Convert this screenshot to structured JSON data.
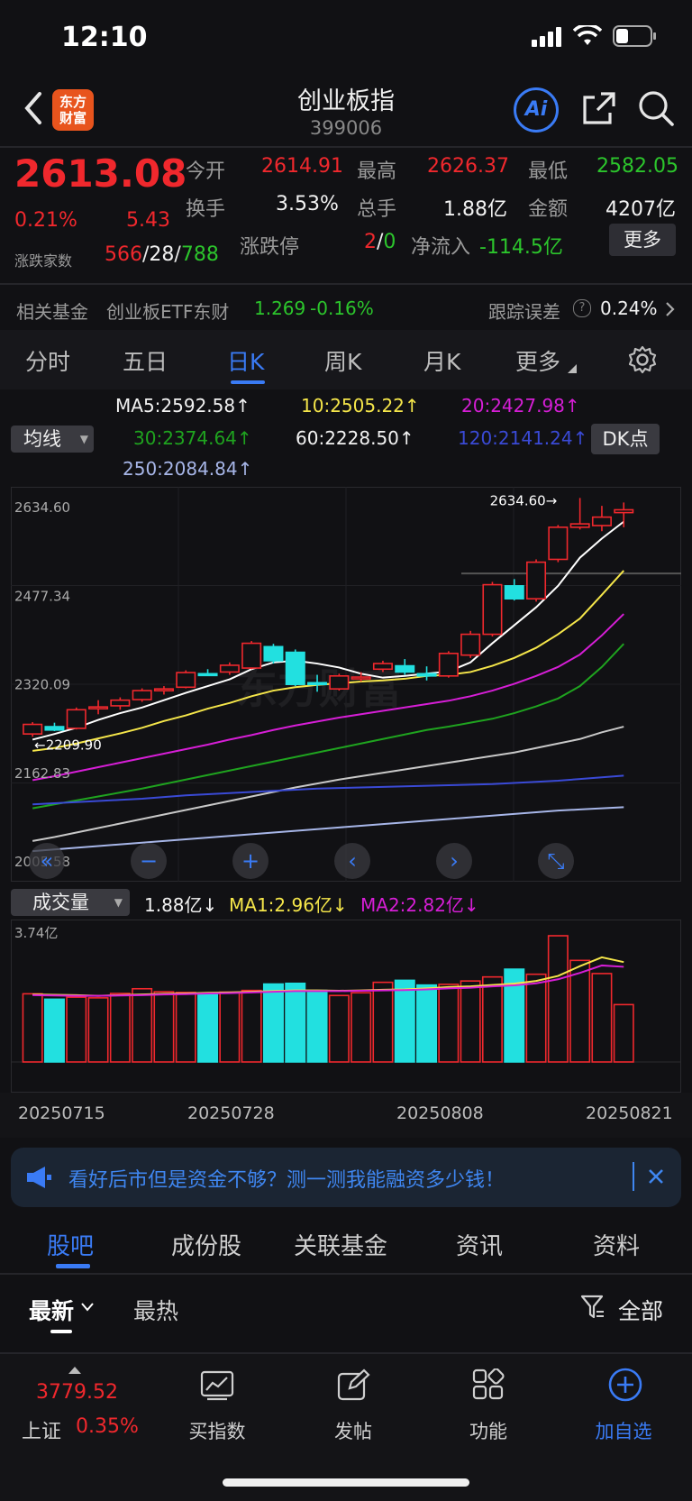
{
  "status_bar": {
    "time": "12:10"
  },
  "header": {
    "title": "创业板指",
    "code": "399006",
    "logo_text_1": "东方",
    "logo_text_2": "财富",
    "ai_label": "Ai"
  },
  "quote": {
    "price": "2613.08",
    "change_pct": "0.21%",
    "change": "5.43",
    "open_label": "今开",
    "open": "2614.91",
    "high_label": "最高",
    "high": "2626.37",
    "low_label": "最低",
    "low": "2582.05",
    "turnover_label": "换手",
    "turnover": "3.53%",
    "volume_label": "总手",
    "volume": "1.88亿",
    "amount_label": "金额",
    "amount": "4207亿",
    "breadth_label": "涨跌家数",
    "up": "566",
    "flat": "28",
    "down": "788",
    "limit_label": "涨跌停",
    "limit_up": "2",
    "limit_down": "0",
    "netflow_label": "净流入",
    "netflow": "-114.5亿",
    "more_label": "更多"
  },
  "fund_row": {
    "label": "相关基金",
    "fund_name": "创业板ETF东财",
    "fund_price": "1.269",
    "fund_change": "-0.16%",
    "tracking_label": "跟踪误差",
    "tracking_value": "0.24%"
  },
  "chart_tabs": [
    "分时",
    "五日",
    "日K",
    "周K",
    "月K",
    "更多"
  ],
  "active_chart_tab": "日K",
  "ma_select": "均线",
  "dk_button": "DK点",
  "ma_values": {
    "ma5": "MA5:2592.58↑",
    "ma10": "10:2505.22↑",
    "ma20": "20:2427.98↑",
    "ma30": "30:2374.64↑",
    "ma60": "60:2228.50↑",
    "ma120": "120:2141.24↑",
    "ma250": "250:2084.84↑"
  },
  "colors": {
    "up": "#f0282d",
    "down": "#22e0e0",
    "ma5": "#ffffff",
    "ma10": "#f5e64a",
    "ma20": "#d61ed6",
    "ma30": "#1fa31f",
    "ma60": "#c8c8c8",
    "ma120": "#3a4ad6",
    "ma250": "#a7b6e8",
    "accent": "#3a7bf5"
  },
  "volume_panel": {
    "select": "成交量",
    "vol": "1.88亿↓",
    "ma1": "MA1:2.96亿↓",
    "ma2": "MA2:2.82亿↓",
    "max_label": "3.74亿"
  },
  "chart_data": {
    "type": "candlestick",
    "y_ticks": [
      "2634.60",
      "2477.34",
      "2320.09",
      "2162.83",
      "2005.58"
    ],
    "ylim": [
      2005.58,
      2634.6
    ],
    "high_marker": "2634.60",
    "low_marker": "2209.90",
    "x_labels": [
      "20250715",
      "20250728",
      "20250808",
      "20250821"
    ],
    "candles": [
      {
        "o": 2215,
        "c": 2232,
        "h": 2236,
        "l": 2210
      },
      {
        "o": 2228,
        "c": 2222,
        "h": 2235,
        "l": 2220
      },
      {
        "o": 2225,
        "c": 2258,
        "h": 2262,
        "l": 2223
      },
      {
        "o": 2262,
        "c": 2263,
        "h": 2275,
        "l": 2250
      },
      {
        "o": 2265,
        "c": 2275,
        "h": 2280,
        "l": 2258
      },
      {
        "o": 2276,
        "c": 2292,
        "h": 2296,
        "l": 2272
      },
      {
        "o": 2292,
        "c": 2295,
        "h": 2300,
        "l": 2285
      },
      {
        "o": 2298,
        "c": 2324,
        "h": 2328,
        "l": 2296
      },
      {
        "o": 2322,
        "c": 2320,
        "h": 2330,
        "l": 2318
      },
      {
        "o": 2325,
        "c": 2337,
        "h": 2342,
        "l": 2320
      },
      {
        "o": 2332,
        "c": 2376,
        "h": 2380,
        "l": 2330
      },
      {
        "o": 2370,
        "c": 2345,
        "h": 2375,
        "l": 2340
      },
      {
        "o": 2360,
        "c": 2303,
        "h": 2365,
        "l": 2300
      },
      {
        "o": 2306,
        "c": 2305,
        "h": 2320,
        "l": 2290
      },
      {
        "o": 2295,
        "c": 2318,
        "h": 2322,
        "l": 2292
      },
      {
        "o": 2315,
        "c": 2316,
        "h": 2325,
        "l": 2308
      },
      {
        "o": 2330,
        "c": 2340,
        "h": 2345,
        "l": 2325
      },
      {
        "o": 2336,
        "c": 2325,
        "h": 2348,
        "l": 2320
      },
      {
        "o": 2322,
        "c": 2318,
        "h": 2335,
        "l": 2310
      },
      {
        "o": 2318,
        "c": 2358,
        "h": 2362,
        "l": 2315
      },
      {
        "o": 2355,
        "c": 2392,
        "h": 2398,
        "l": 2350
      },
      {
        "o": 2392,
        "c": 2480,
        "h": 2485,
        "l": 2388
      },
      {
        "o": 2478,
        "c": 2455,
        "h": 2490,
        "l": 2452
      },
      {
        "o": 2455,
        "c": 2520,
        "h": 2525,
        "l": 2450
      },
      {
        "o": 2525,
        "c": 2582,
        "h": 2586,
        "l": 2520
      },
      {
        "o": 2582,
        "c": 2588,
        "h": 2634,
        "l": 2578
      },
      {
        "o": 2585,
        "c": 2600,
        "h": 2620,
        "l": 2575
      },
      {
        "o": 2608,
        "c": 2613,
        "h": 2626,
        "l": 2582
      }
    ],
    "ma_series": [
      {
        "name": "MA5",
        "color": "#ffffff",
        "values": [
          2205,
          2215,
          2226,
          2240,
          2252,
          2262,
          2275,
          2288,
          2300,
          2312,
          2330,
          2342,
          2345,
          2340,
          2333,
          2322,
          2315,
          2318,
          2322,
          2326,
          2342,
          2376,
          2408,
          2440,
          2478,
          2528,
          2562,
          2592
        ]
      },
      {
        "name": "MA10",
        "color": "#f5e64a",
        "values": [
          2185,
          2190,
          2198,
          2207,
          2216,
          2226,
          2238,
          2248,
          2260,
          2270,
          2282,
          2292,
          2298,
          2302,
          2305,
          2308,
          2310,
          2313,
          2318,
          2320,
          2325,
          2336,
          2350,
          2368,
          2392,
          2420,
          2462,
          2505
        ]
      },
      {
        "name": "MA20",
        "color": "#d61ed6",
        "values": [
          2133,
          2140,
          2148,
          2156,
          2164,
          2172,
          2180,
          2188,
          2196,
          2205,
          2213,
          2222,
          2230,
          2237,
          2244,
          2250,
          2256,
          2262,
          2268,
          2274,
          2282,
          2292,
          2304,
          2318,
          2334,
          2356,
          2390,
          2428
        ]
      },
      {
        "name": "MA30",
        "color": "#1fa31f",
        "values": [
          2083,
          2090,
          2097,
          2104,
          2111,
          2118,
          2126,
          2134,
          2142,
          2150,
          2158,
          2166,
          2174,
          2182,
          2190,
          2198,
          2206,
          2214,
          2222,
          2228,
          2235,
          2242,
          2252,
          2264,
          2278,
          2300,
          2334,
          2375
        ]
      },
      {
        "name": "MA60",
        "color": "#c8c8c8",
        "values": [
          2025,
          2032,
          2040,
          2048,
          2056,
          2064,
          2072,
          2080,
          2088,
          2096,
          2104,
          2112,
          2120,
          2127,
          2134,
          2140,
          2146,
          2152,
          2158,
          2164,
          2170,
          2176,
          2182,
          2190,
          2198,
          2206,
          2218,
          2228
        ]
      },
      {
        "name": "MA120",
        "color": "#3a4ad6",
        "values": [
          2090,
          2092,
          2094,
          2096,
          2098,
          2100,
          2103,
          2106,
          2108,
          2110,
          2112,
          2114,
          2116,
          2118,
          2119,
          2120,
          2121,
          2122,
          2123,
          2124,
          2125,
          2126,
          2128,
          2130,
          2132,
          2135,
          2138,
          2141
        ]
      },
      {
        "name": "MA250",
        "color": "#a7b6e8",
        "values": [
          2007,
          2010,
          2013,
          2016,
          2019,
          2022,
          2025,
          2028,
          2031,
          2034,
          2037,
          2040,
          2043,
          2046,
          2049,
          2052,
          2055,
          2058,
          2061,
          2064,
          2067,
          2070,
          2073,
          2076,
          2079,
          2081,
          2083,
          2085
        ]
      }
    ],
    "volume": {
      "ylim": [
        0,
        3.74
      ],
      "values": [
        2.02,
        1.86,
        1.92,
        1.9,
        2.03,
        2.17,
        2.08,
        2.06,
        2.04,
        2.07,
        2.12,
        2.31,
        2.33,
        2.12,
        1.97,
        2.05,
        2.36,
        2.42,
        2.28,
        2.3,
        2.4,
        2.52,
        2.75,
        2.6,
        3.74,
        3.01,
        2.62,
        1.7
      ],
      "ma1": [
        2.0,
        1.99,
        1.98,
        1.96,
        1.98,
        2.0,
        2.02,
        2.03,
        2.05,
        2.06,
        2.08,
        2.1,
        2.12,
        2.12,
        2.11,
        2.12,
        2.14,
        2.15,
        2.18,
        2.22,
        2.24,
        2.28,
        2.32,
        2.4,
        2.55,
        2.84,
        3.1,
        2.96
      ],
      "ma2": [
        1.98,
        1.97,
        1.96,
        1.96,
        1.97,
        1.98,
        2.0,
        2.01,
        2.03,
        2.04,
        2.06,
        2.08,
        2.1,
        2.1,
        2.1,
        2.11,
        2.12,
        2.13,
        2.15,
        2.18,
        2.2,
        2.24,
        2.27,
        2.33,
        2.45,
        2.64,
        2.86,
        2.82
      ]
    }
  },
  "ad": {
    "text": "看好后市但是资金不够？测一测我能融资多少钱！"
  },
  "bottom_tabs": [
    "股吧",
    "成份股",
    "关联基金",
    "资讯",
    "资料"
  ],
  "active_bottom_tab": "股吧",
  "sub_tabs": {
    "latest": "最新",
    "hottest": "最热",
    "filter": "全部"
  },
  "nav": {
    "index_price": "3779.52",
    "index_name": "上证",
    "index_change": "0.35%",
    "buy_index": "买指数",
    "post": "发帖",
    "functions": "功能",
    "add_watch": "加自选"
  }
}
